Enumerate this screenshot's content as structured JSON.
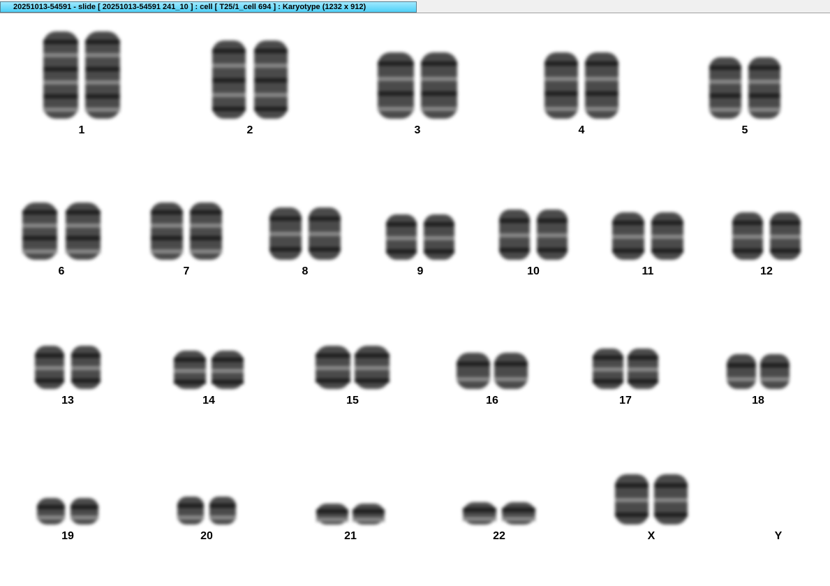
{
  "window": {
    "title": "20251013-54591 - slide [ 20251013-54591 241_10 ] : cell [ T25/1_cell 694 ] : Karyotype  (1232 x 912)"
  },
  "karyotype": {
    "chromosomes": [
      {
        "label": "1",
        "copies": 2
      },
      {
        "label": "2",
        "copies": 2
      },
      {
        "label": "3",
        "copies": 2
      },
      {
        "label": "4",
        "copies": 2
      },
      {
        "label": "5",
        "copies": 2
      },
      {
        "label": "6",
        "copies": 2
      },
      {
        "label": "7",
        "copies": 2
      },
      {
        "label": "8",
        "copies": 2
      },
      {
        "label": "9",
        "copies": 2
      },
      {
        "label": "10",
        "copies": 2
      },
      {
        "label": "11",
        "copies": 2
      },
      {
        "label": "12",
        "copies": 2
      },
      {
        "label": "13",
        "copies": 2
      },
      {
        "label": "14",
        "copies": 2
      },
      {
        "label": "15",
        "copies": 2
      },
      {
        "label": "16",
        "copies": 2
      },
      {
        "label": "17",
        "copies": 2
      },
      {
        "label": "18",
        "copies": 2
      },
      {
        "label": "19",
        "copies": 2
      },
      {
        "label": "20",
        "copies": 2
      },
      {
        "label": "21",
        "copies": 2
      },
      {
        "label": "22",
        "copies": 2
      },
      {
        "label": "X",
        "copies": 2
      },
      {
        "label": "Y",
        "copies": 0
      }
    ]
  },
  "colors": {
    "title_tab_top": "#9fe9ff",
    "title_tab_bottom": "#4fd0f7",
    "chromosome": "#4a4a4a",
    "background": "#ffffff"
  }
}
